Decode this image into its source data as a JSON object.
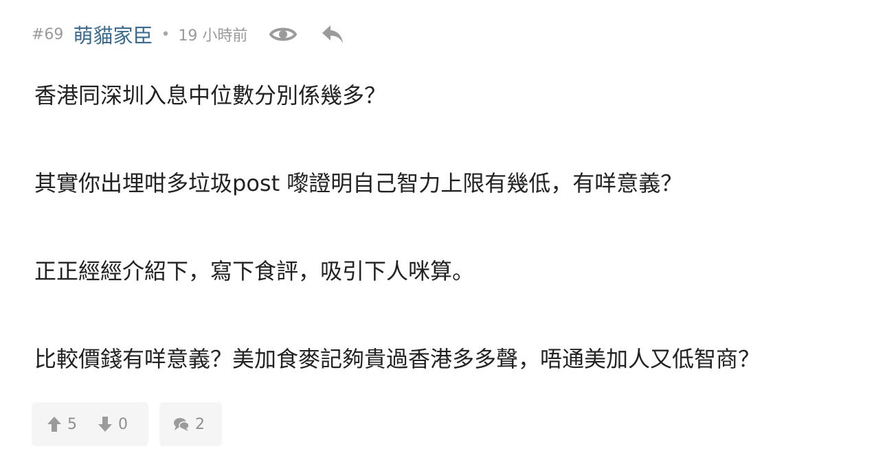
{
  "post": {
    "number": "#69",
    "author": "萌貓家臣",
    "separator": "•",
    "time": "19 小時前",
    "icons": {
      "view": "eye-icon",
      "reply": "reply-icon",
      "upvote": "arrow-up-icon",
      "downvote": "arrow-down-icon",
      "comments": "chat-bubbles-icon"
    },
    "paragraphs": [
      "香港同深圳入息中位數分別係幾多？",
      "其實你出埋咁多垃圾post 嚟證明自己智力上限有幾低，有咩意義？",
      "正正經經介紹下，寫下食評，吸引下人咪算。",
      "比較價錢有咩意義？美加食麥記夠貴過香港多多聲，唔通美加人又低智商？"
    ],
    "upvotes": "5",
    "downvotes": "0",
    "comments": "2"
  },
  "colors": {
    "author": "#3a6b8f",
    "meta": "#9a9a9a",
    "body_text": "#222222",
    "button_bg": "#f5f5f5",
    "icon": "#9b9b9b"
  }
}
